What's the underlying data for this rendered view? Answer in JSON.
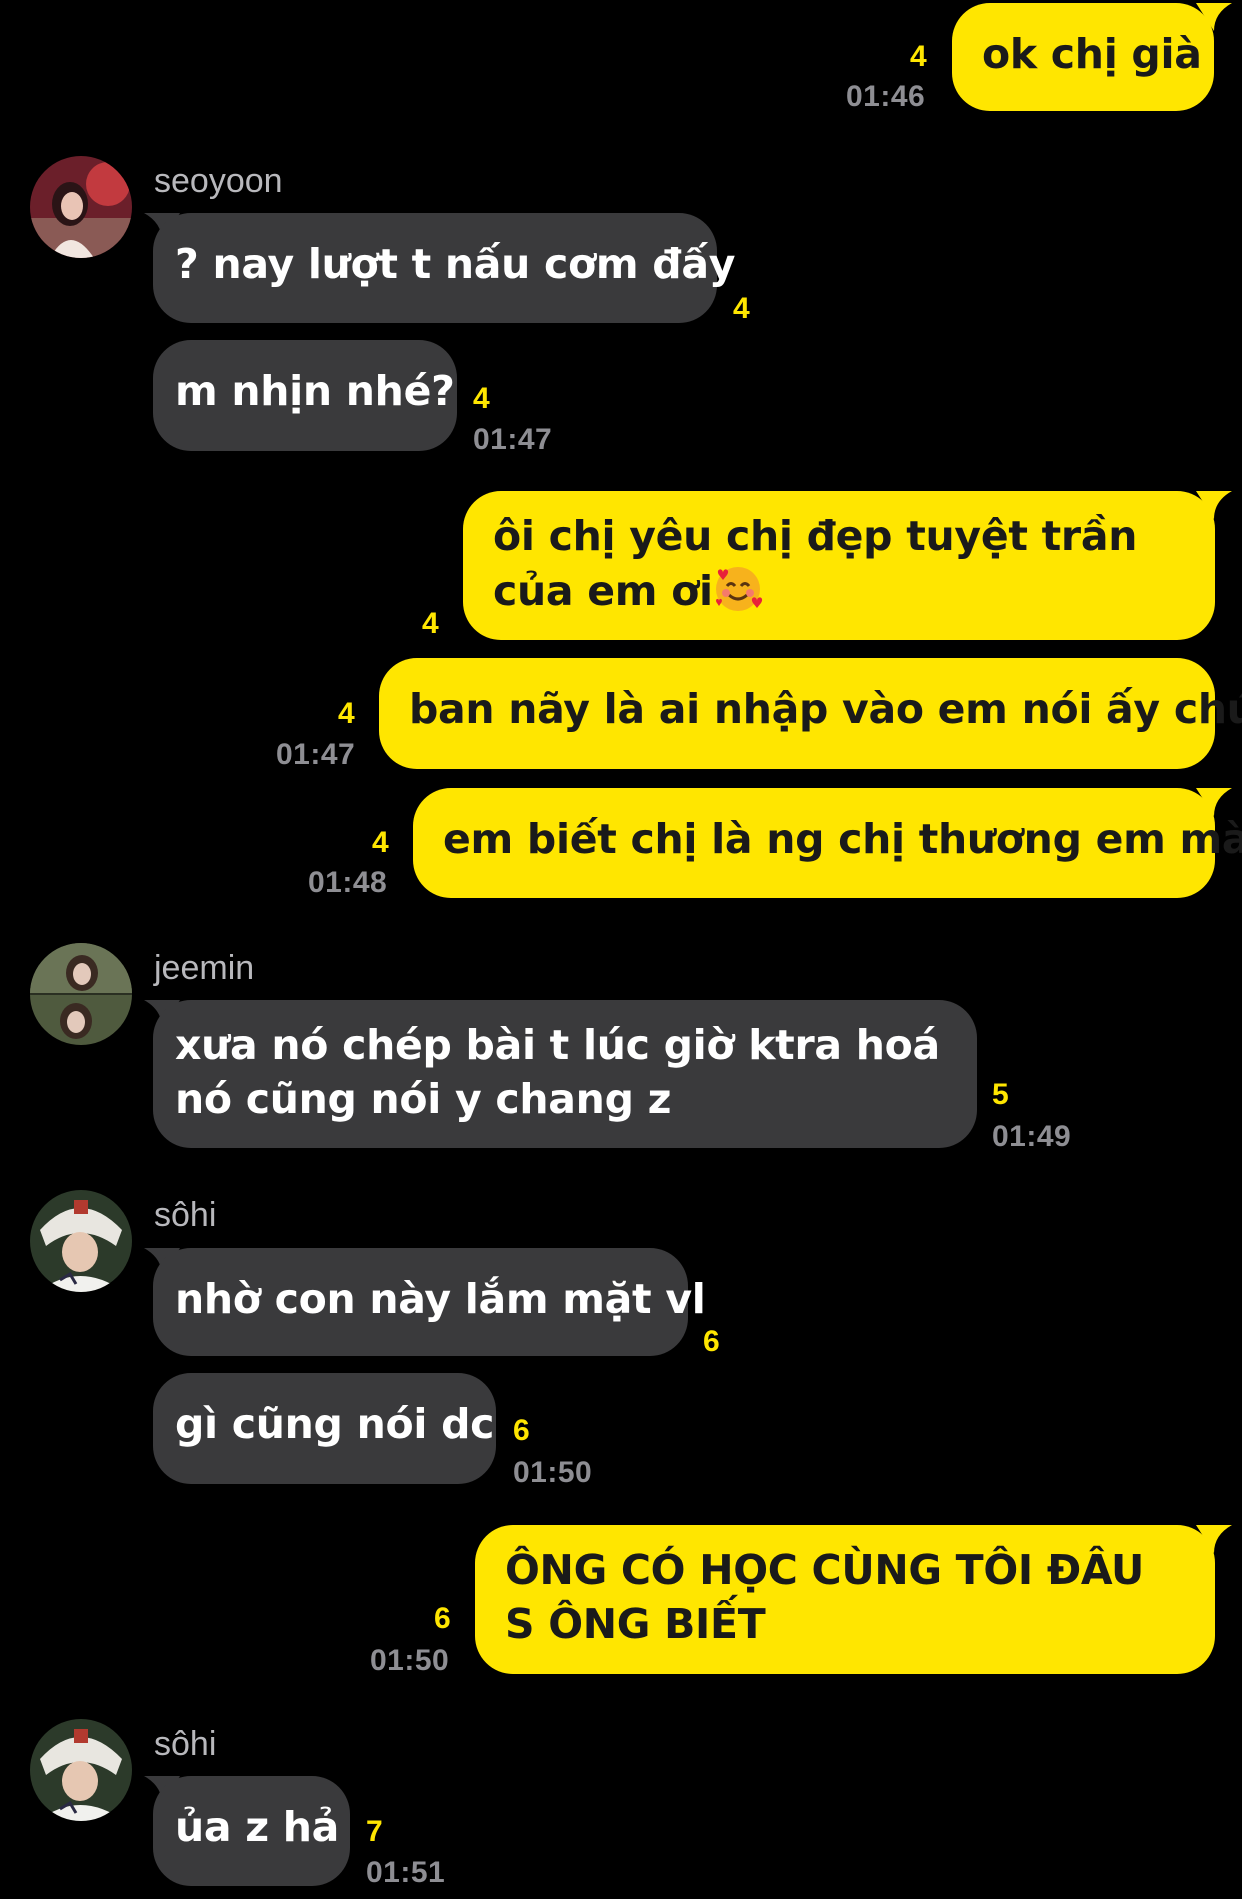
{
  "messages": [
    {
      "text": "ok chị già",
      "unread": "4",
      "time": "01:46"
    },
    {
      "sender": "seoyoon"
    },
    {
      "text": "? nay lượt t nấu cơm đấy",
      "unread": "4"
    },
    {
      "text": "m nhịn nhé?",
      "unread": "4",
      "time": "01:47"
    },
    {
      "text": "ôi chị yêu chị đẹp tuyệt trần của em ơi",
      "emoji": "smiling-face-with-hearts",
      "unread": "4"
    },
    {
      "text": "ban nãy là ai nhập vào em nói ấy chứ",
      "unread": "4",
      "time": "01:47"
    },
    {
      "text": "em biết chị là ng chị thương em mà",
      "unread": "4",
      "time": "01:48"
    },
    {
      "sender": "jeemin"
    },
    {
      "text": "xưa nó chép bài t lúc giờ ktra hoá nó cũng nói y chang z",
      "unread": "5",
      "time": "01:49"
    },
    {
      "sender": "sôhi"
    },
    {
      "text": "nhờ con này lắm mặt vl",
      "unread": "6"
    },
    {
      "text": "gì cũng nói dc",
      "unread": "6",
      "time": "01:50"
    },
    {
      "text": "ÔNG CÓ HỌC CÙNG TÔI ĐÂU S ÔNG BIẾT",
      "unread": "6",
      "time": "01:50"
    },
    {
      "sender": "sôhi"
    },
    {
      "text": "ủa z hả",
      "unread": "7",
      "time": "01:51"
    }
  ],
  "colors": {
    "background": "#000000",
    "outgoing_bubble": "#ffe600",
    "incoming_bubble": "#3a3a3c",
    "unread_count": "#ffe600",
    "timestamp": "#8e8e93",
    "sender_name": "#b8b8bc"
  }
}
